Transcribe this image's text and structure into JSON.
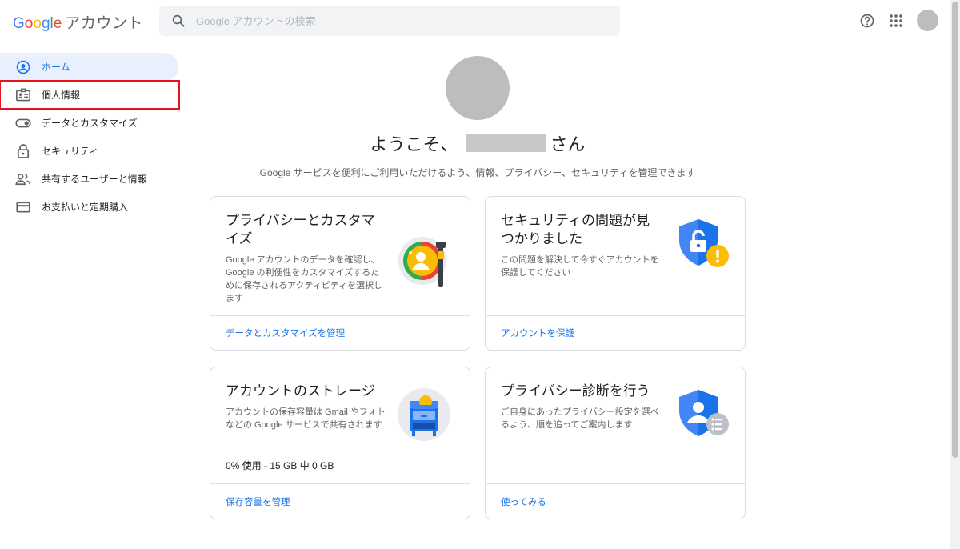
{
  "header": {
    "logo_letters": [
      {
        "ch": "G",
        "color": "#4285f4"
      },
      {
        "ch": "o",
        "color": "#ea4335"
      },
      {
        "ch": "o",
        "color": "#fbbc05"
      },
      {
        "ch": "g",
        "color": "#4285f4"
      },
      {
        "ch": "l",
        "color": "#34a853"
      },
      {
        "ch": "e",
        "color": "#ea4335"
      }
    ],
    "product": "アカウント",
    "search_placeholder": "Google アカウントの検索"
  },
  "sidebar": {
    "items": [
      {
        "label": "ホーム",
        "icon": "account-circle-icon"
      },
      {
        "label": "個人情報",
        "icon": "id-card-icon"
      },
      {
        "label": "データとカスタマイズ",
        "icon": "toggle-icon"
      },
      {
        "label": "セキュリティ",
        "icon": "lock-icon"
      },
      {
        "label": "共有するユーザーと情報",
        "icon": "people-icon"
      },
      {
        "label": "お支払いと定期購入",
        "icon": "credit-card-icon"
      }
    ]
  },
  "main": {
    "welcome_prefix": "ようこそ、",
    "welcome_suffix": "さん",
    "subtitle": "Google サービスを便利にご利用いただけるよう、情報、プライバシー、セキュリティを管理できます"
  },
  "cards": {
    "privacy": {
      "title": "プライバシーとカスタマイズ",
      "desc": "Google アカウントのデータを確認し、Google の利便性をカスタマイズするために保存されるアクティビティを選択します",
      "link": "データとカスタマイズを管理"
    },
    "security": {
      "title": "セキュリティの問題が見つかりました",
      "desc": "この問題を解決して今すぐアカウントを保護してください",
      "link": "アカウントを保護"
    },
    "storage": {
      "title": "アカウントのストレージ",
      "desc": "アカウントの保存容量は Gmail やフォトなどの Google サービスで共有されます",
      "usage": "0% 使用 - 15 GB 中 0 GB",
      "link": "保存容量を管理"
    },
    "checkup": {
      "title": "プライバシー診断を行う",
      "desc": "ご自身にあったプライバシー設定を選べるよう、順を追ってご案内します",
      "link": "使ってみる"
    }
  },
  "colors": {
    "accent": "#1a73e8",
    "active_bg": "#e8f0fe",
    "highlight_border": "#e3141c"
  }
}
